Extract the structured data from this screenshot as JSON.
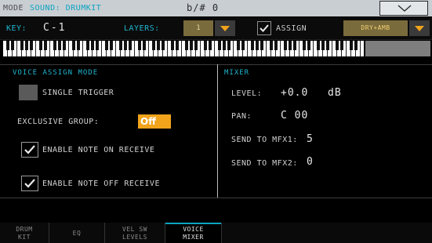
{
  "topbar": {
    "mode": "MODE",
    "sound": "SOUND: DRUMKIT",
    "sharp": "b/# 0"
  },
  "keyrow": {
    "key_label": "KEY:",
    "key_value": "C-1",
    "layers_label": "LAYERS:",
    "layers_value": "1",
    "assign_checked": true,
    "assign_label": "ASSIGN",
    "mode_value": "DRY+AMB"
  },
  "voice_assign": {
    "title": "VOICE ASSIGN MODE",
    "single_trigger_label": "SINGLE TRIGGER",
    "single_trigger_checked": false,
    "exclusive_group_label": "EXCLUSIVE GROUP:",
    "exclusive_group_value": "Off",
    "note_on_label": "ENABLE NOTE ON RECEIVE",
    "note_on_checked": true,
    "note_off_label": "ENABLE NOTE OFF RECEIVE",
    "note_off_checked": true
  },
  "mixer": {
    "title": "MIXER",
    "level_label": "LEVEL:",
    "level_value": "+0.0",
    "level_unit": "dB",
    "pan_label": "PAN:",
    "pan_value": "C 00",
    "mfx1_label": "SEND TO MFX1:",
    "mfx1_value": "5",
    "mfx2_label": "SEND TO MFX2:",
    "mfx2_value": "0"
  },
  "tabs": [
    {
      "line1": "DRUM",
      "line2": "KIT",
      "active": false
    },
    {
      "line1": "EQ",
      "line2": "",
      "active": false
    },
    {
      "line1": "VEL SW",
      "line2": "LEVELS",
      "active": false
    },
    {
      "line1": "VOICE",
      "line2": "MIXER",
      "active": true
    }
  ],
  "colors": {
    "accent": "#1fb5cf",
    "highlight": "#f0a31b",
    "tab_active_border": "#0aa5c0"
  },
  "icons": {
    "dropdown": "triangle-down-icon",
    "check": "check-icon"
  }
}
